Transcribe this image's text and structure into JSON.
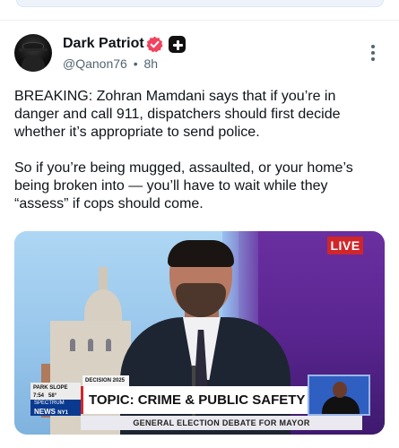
{
  "post": {
    "author_name": "Dark Patriot",
    "handle": "@Qanon76",
    "separator": "•",
    "time": "8h",
    "paragraphs": [
      "BREAKING: Zohran Mamdani says that if you’re in danger and call 911, dispatchers should first decide whether it’s appropriate to send police.",
      "So if you’re being mugged, assaulted, or your home’s being broken into — you’ll have to wait while they “assess” if cops should come."
    ]
  },
  "media": {
    "live_label": "LIVE",
    "decision_label": "DECISION 2025",
    "location_label": "PARK SLOPE",
    "clock": "7:54",
    "temperature": "58°",
    "channel_top": "SPECTRUM",
    "channel_bottom": "NEWS",
    "channel_number": "NY1",
    "topic": "TOPIC: CRIME & PUBLIC SAFETY",
    "subtitle": "GENERAL ELECTION DEBATE FOR MAYOR"
  },
  "icons": {
    "verified": "verified-badge-icon",
    "plus": "plus-badge-icon",
    "more": "more-options-icon"
  },
  "colors": {
    "verified_badge": "#f0435e",
    "live": "#d0262a",
    "spectrum": "#0a3a8f"
  }
}
